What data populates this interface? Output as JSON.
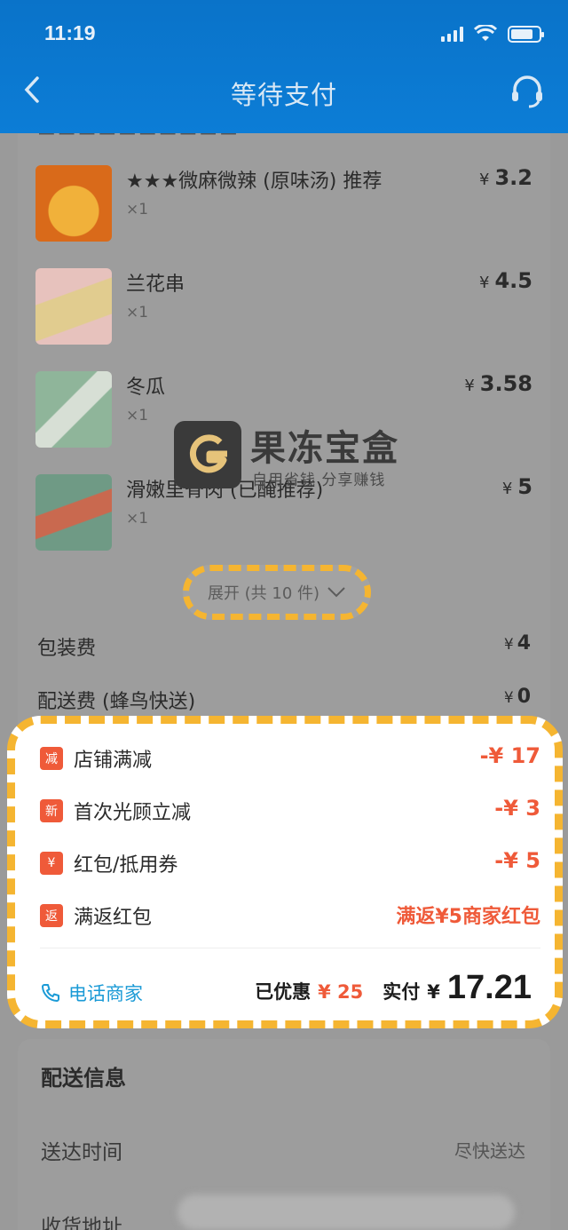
{
  "status_bar": {
    "time": "11:19"
  },
  "nav": {
    "title": "等待支付"
  },
  "items": [
    {
      "name": "★★★微麻微辣 (原味汤) 推荐",
      "qty": "×1",
      "price": "3.2",
      "thumb_color": "#d96a1a"
    },
    {
      "name": "兰花串",
      "qty": "×1",
      "price": "4.5",
      "thumb_color": "#e3b7b2"
    },
    {
      "name": "冬瓜",
      "qty": "×1",
      "price": "3.58",
      "thumb_color": "#8fb59a"
    },
    {
      "name": "滑嫩里脊肉 (已醃推荐)",
      "qty": "×1",
      "price": "5",
      "thumb_color": "#6f9a85"
    }
  ],
  "currency": "¥",
  "expand": {
    "label": "展开 (共 10 件)"
  },
  "fees": {
    "packing_label": "包装费",
    "packing_value": "4",
    "delivery_label": "配送费 (蜂鸟快送)",
    "delivery_value": "0"
  },
  "watermark": {
    "title": "果冻宝盒",
    "subtitle": "自用省钱 分享赚钱"
  },
  "discounts": [
    {
      "tag": "减",
      "label": "店铺满减",
      "amount": "-¥ 17"
    },
    {
      "tag": "新",
      "label": "首次光顾立减",
      "amount": "-¥ 3"
    },
    {
      "tag": "¥",
      "label": "红包/抵用券",
      "amount": "-¥ 5"
    },
    {
      "tag": "返",
      "label": "满返红包",
      "amount": "满返¥5商家红包"
    }
  ],
  "footer": {
    "call_label": "电话商家",
    "saved_label": "已优惠",
    "saved_value": "¥ 25",
    "paid_label": "实付",
    "paid_currency": "¥",
    "paid_value": "17.21"
  },
  "delivery": {
    "title": "配送信息",
    "time_label": "送达时间",
    "time_value": "尽快送达",
    "address_label": "收货地址"
  },
  "colors": {
    "brand_blue": "#0c7dd6",
    "discount_red": "#ef5a39",
    "highlight_yellow": "#f5b531",
    "link_blue": "#1a9ad6"
  }
}
